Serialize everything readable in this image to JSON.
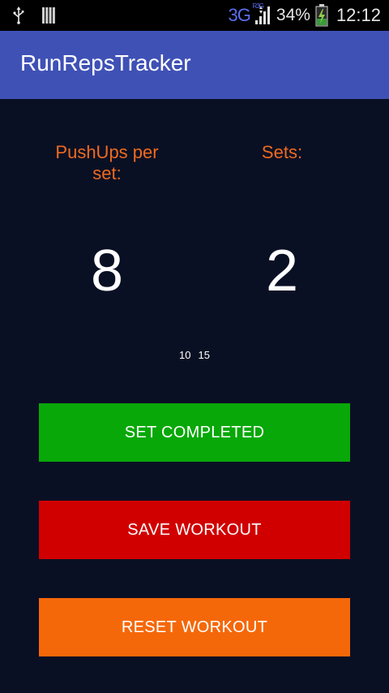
{
  "status_bar": {
    "left_icons": [
      "usb-icon",
      "sdcard-icon"
    ],
    "network": "3G",
    "network_sub": "R3G",
    "battery_percent": "34%",
    "time": "12:12"
  },
  "app_bar": {
    "title": "RunRepsTracker"
  },
  "labels": {
    "pushups": "PushUps per set:",
    "sets": "Sets:"
  },
  "values": {
    "pushups": "8",
    "sets": "2"
  },
  "history": [
    "10",
    "15"
  ],
  "buttons": {
    "set_completed": "SET COMPLETED",
    "save_workout": "SAVE WORKOUT",
    "reset_workout": "RESET WORKOUT"
  },
  "colors": {
    "background": "#0a1024",
    "app_bar": "#3f51b5",
    "label": "#ee6a1f",
    "set_completed": "#08a808",
    "save_workout": "#d10000",
    "reset_workout": "#f5680a"
  }
}
